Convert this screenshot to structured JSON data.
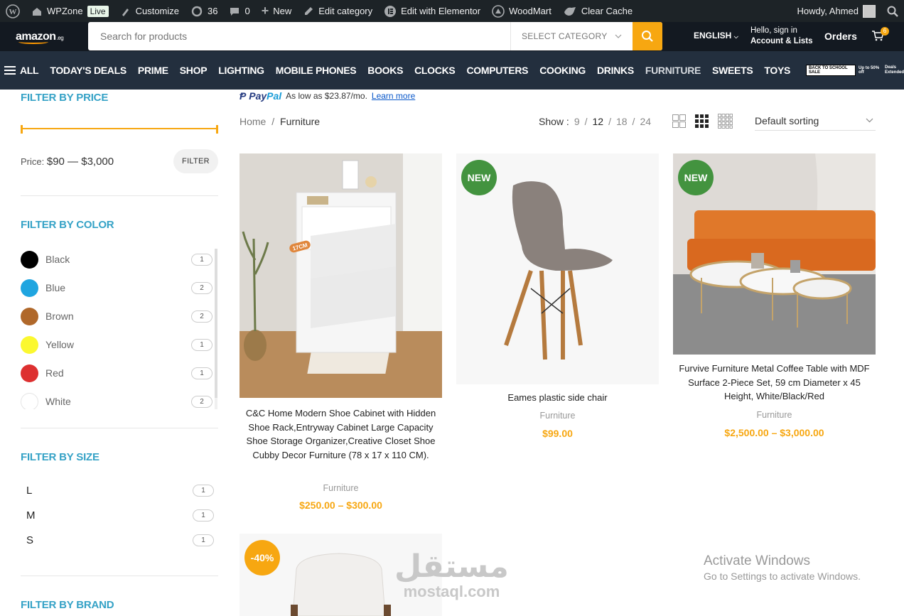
{
  "admin_bar": {
    "site_name": "WPZone",
    "live_badge": "Live",
    "customize": "Customize",
    "updates_count": "36",
    "comments_count": "0",
    "new_label": "New",
    "edit_category": "Edit category",
    "elementor": "Edit with Elementor",
    "woodmart": "WoodMart",
    "clear_cache": "Clear Cache",
    "howdy": "Howdy, Ahmed"
  },
  "header": {
    "logo_text": "amazon",
    "logo_suffix": ".eg",
    "search_placeholder": "Search for products",
    "category_select": "SELECT CATEGORY",
    "language": "ENGLISH",
    "account_line1": "Hello, sign in",
    "account_line2": "Account & Lists",
    "orders": "Orders",
    "cart_count": "6",
    "accent_color": "#f7a711"
  },
  "nav": {
    "all": "ALL",
    "items": [
      "TODAY'S DEALS",
      "PRIME",
      "SHOP",
      "LIGHTING",
      "MOBILE PHONES",
      "BOOKS",
      "CLOCKS",
      "COMPUTERS",
      "COOKING",
      "DRINKS",
      "FURNITURE",
      "SWEETS",
      "TOYS"
    ],
    "promo_label": "BACK TO SCHOOL SALE",
    "promo_text": "Up to 50% off",
    "promo_extra_1": "Deals",
    "promo_extra_2": "Extended"
  },
  "sidebar": {
    "price_title": "FILTER BY PRICE",
    "price_prefix": "Price:",
    "price_range": "$90 — $3,000",
    "filter_button": "FILTER",
    "color_title": "FILTER BY COLOR",
    "colors": [
      {
        "name": "Black",
        "count": "1",
        "hex": "#000000"
      },
      {
        "name": "Blue",
        "count": "2",
        "hex": "#1fa5e0"
      },
      {
        "name": "Brown",
        "count": "2",
        "hex": "#b0682a"
      },
      {
        "name": "Yellow",
        "count": "1",
        "hex": "#fbf830"
      },
      {
        "name": "Red",
        "count": "1",
        "hex": "#dd3030"
      },
      {
        "name": "White",
        "count": "2",
        "hex": "#ffffff"
      }
    ],
    "size_title": "FILTER BY SIZE",
    "sizes": [
      {
        "name": "L",
        "count": "1"
      },
      {
        "name": "M",
        "count": "1"
      },
      {
        "name": "S",
        "count": "1"
      }
    ],
    "brand_title": "FILTER BY BRAND"
  },
  "main": {
    "paypal_brand_1": "Pay",
    "paypal_brand_2": "Pal",
    "paypal_text": "As low as $23.87/mo.",
    "paypal_link": "Learn more",
    "breadcrumb_home": "Home",
    "breadcrumb_sep": "/",
    "breadcrumb_current": "Furniture",
    "show_label": "Show :",
    "show_options": [
      "9",
      "12",
      "18",
      "24"
    ],
    "show_separator": "/",
    "sorting": "Default sorting"
  },
  "products": [
    {
      "title": "C&C Home Modern Shoe Cabinet with Hidden Shoe Rack,Entryway Cabinet Large Capacity Shoe Storage Organizer,Creative Closet Shoe Cubby Decor Furniture (78 x 17 x 110 CM).",
      "category": "Furniture",
      "price": "$250.00 – $300.00",
      "badge": "",
      "image_label": "17CM"
    },
    {
      "title": "Eames plastic side chair",
      "category": "Furniture",
      "price": "$99.00",
      "badge": "NEW"
    },
    {
      "title": "Furvive Furniture Metal Coffee Table with MDF Surface 2-Piece Set, 59 cm Diameter x 45 Height, White/Black/Red",
      "category": "Furniture",
      "price": "$2,500.00 – $3,000.00",
      "badge": "NEW"
    },
    {
      "title": "",
      "category": "",
      "price": "",
      "badge": "-40%"
    }
  ],
  "overlay": {
    "watermark_ar": "مستقل",
    "watermark_en": "mostaql.com",
    "activate_title": "Activate Windows",
    "activate_sub": "Go to Settings to activate Windows."
  }
}
